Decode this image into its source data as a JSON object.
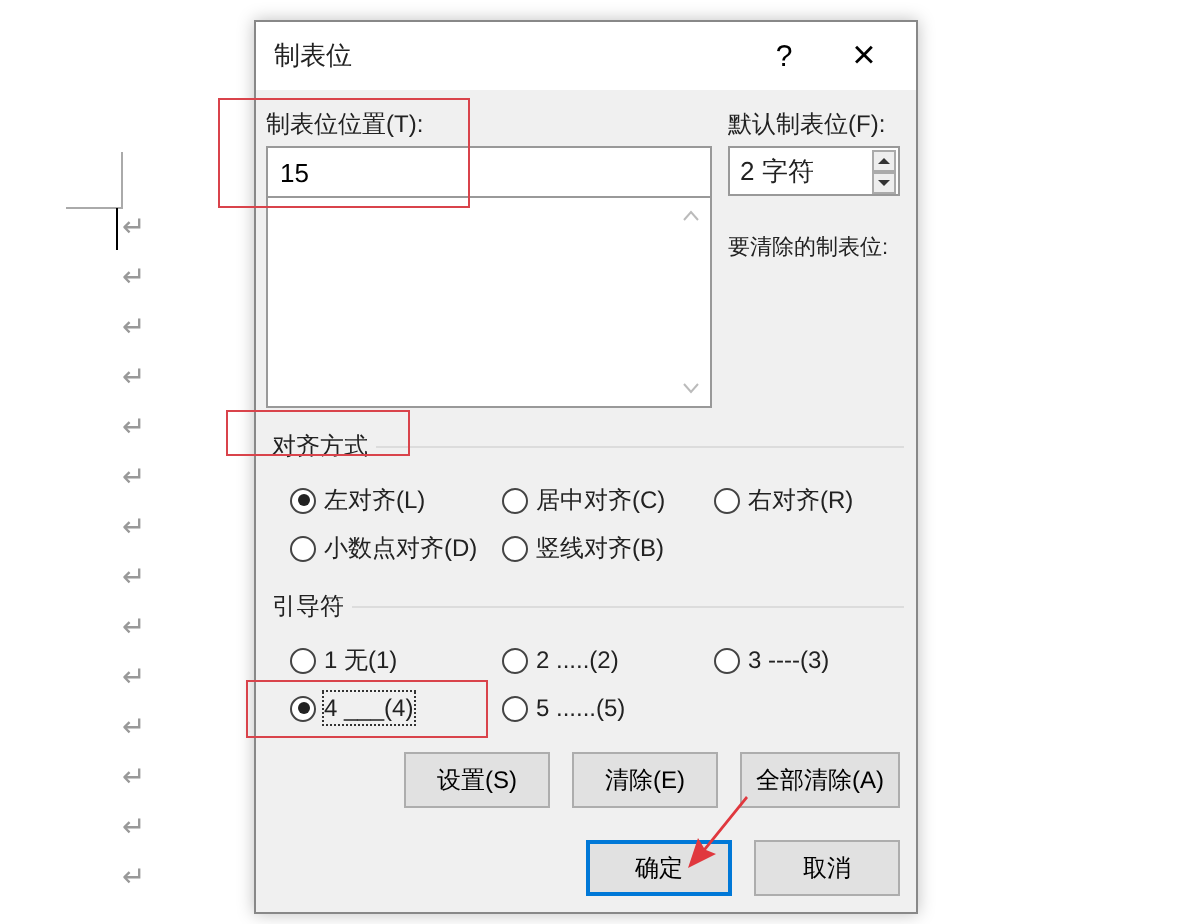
{
  "document": {
    "paragraph_marks": [
      "↵",
      "↵",
      "↵",
      "↵",
      "↵",
      "↵",
      "↵",
      "↵",
      "↵",
      "↵",
      "↵",
      "↵",
      "↵",
      "↵"
    ]
  },
  "dialog": {
    "title": "制表位",
    "help": "?",
    "close": "×",
    "position_label": "制表位位置(T):",
    "position_value": "15",
    "default_label": "默认制表位(F):",
    "default_value": "2 字符",
    "clear_label": "要清除的制表位:",
    "alignment_title": "对齐方式",
    "alignment": [
      {
        "label": "左对齐(L)",
        "selected": true
      },
      {
        "label": "居中对齐(C)",
        "selected": false
      },
      {
        "label": "右对齐(R)",
        "selected": false
      },
      {
        "label": "小数点对齐(D)",
        "selected": false
      },
      {
        "label": "竖线对齐(B)",
        "selected": false
      }
    ],
    "leader_title": "引导符",
    "leader": [
      {
        "label": "1 无(1)",
        "selected": false
      },
      {
        "label": "2 .....(2)",
        "selected": false
      },
      {
        "label": "3 ----(3)",
        "selected": false
      },
      {
        "label": "4 ___(4)",
        "selected": true
      },
      {
        "label": "5 ......(5)",
        "selected": false
      }
    ],
    "actions": [
      "设置(S)",
      "清除(E)",
      "全部清除(A)"
    ],
    "ok": "确定",
    "cancel": "取消"
  }
}
